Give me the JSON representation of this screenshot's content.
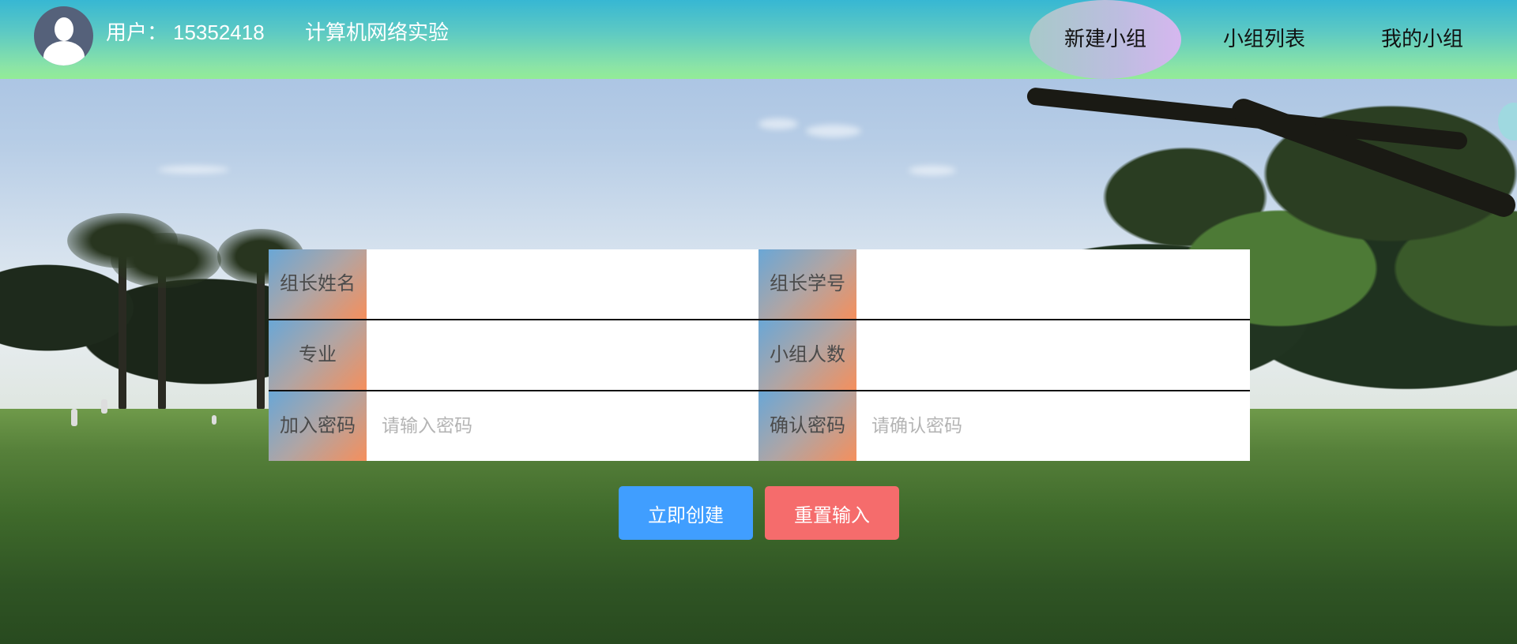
{
  "header": {
    "user_label": "用户：",
    "user_id": "15352418",
    "course": "计算机网络实验",
    "nav": [
      {
        "label": "新建小组",
        "active": true
      },
      {
        "label": "小组列表",
        "active": false
      },
      {
        "label": "我的小组",
        "active": false
      }
    ]
  },
  "form": {
    "rows": [
      [
        {
          "label": "组长姓名",
          "value": "",
          "placeholder": ""
        },
        {
          "label": "组长学号",
          "value": "",
          "placeholder": ""
        }
      ],
      [
        {
          "label": "专业",
          "value": "",
          "placeholder": ""
        },
        {
          "label": "小组人数",
          "value": "",
          "placeholder": ""
        }
      ],
      [
        {
          "label": "加入密码",
          "value": "",
          "placeholder": "请输入密码"
        },
        {
          "label": "确认密码",
          "value": "",
          "placeholder": "请确认密码"
        }
      ]
    ]
  },
  "buttons": {
    "create": "立即创建",
    "reset": "重置输入"
  },
  "colors": {
    "create": "#409eff",
    "reset": "#f56c6c",
    "header_start": "#37b7d3",
    "header_end": "#93ec96"
  }
}
